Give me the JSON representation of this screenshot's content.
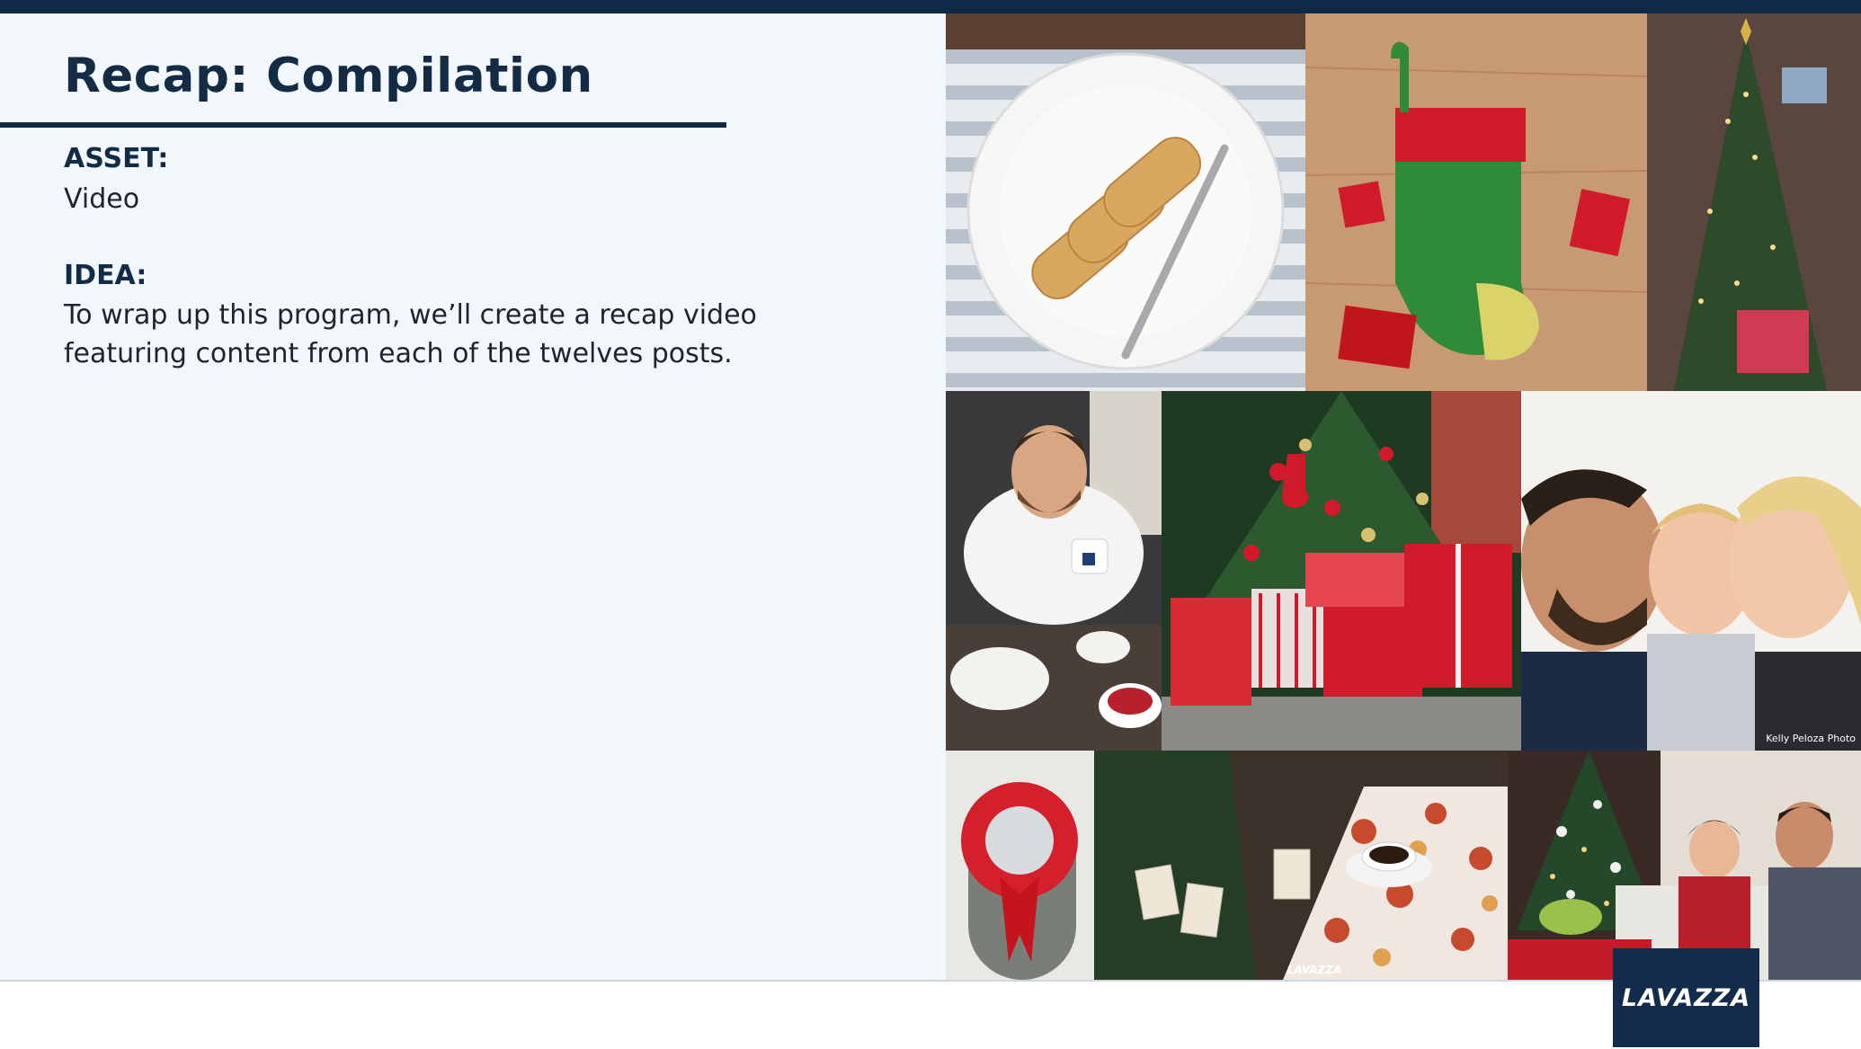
{
  "slide": {
    "title": "Recap: Compilation",
    "asset_label": "ASSET:",
    "asset_value": "Video",
    "idea_label": "IDEA:",
    "idea_text_line1": "To wrap up this program, we’ll create a recap video",
    "idea_text_line2": "featuring content from each of the twelves posts."
  },
  "collage": {
    "photo_credit": "Kelly Peloza Photo",
    "mug_brand": "LAVAZZA"
  },
  "footer": {
    "logo": "LAVAZZA"
  },
  "colors": {
    "navy": "#142b46",
    "panel_bg": "#f2f7fc",
    "accent_red": "#d11a2a",
    "accent_green": "#2f7a3b"
  }
}
